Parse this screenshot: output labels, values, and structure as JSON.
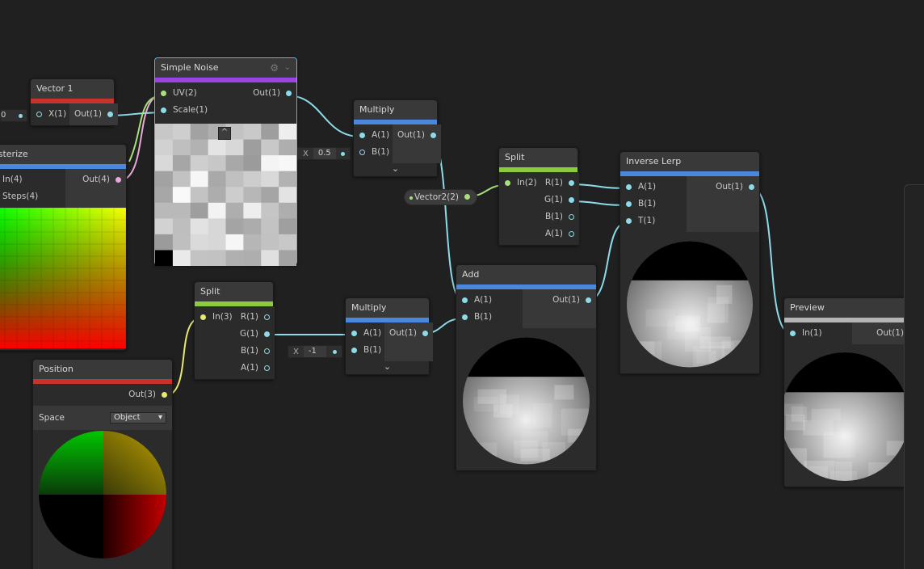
{
  "nodes": {
    "vector1": {
      "title": "Vector 1",
      "in0": "X(1)",
      "out0": "Out(1)",
      "inline_value": "0"
    },
    "posterize": {
      "title": "osterize",
      "in0": "In(4)",
      "in1": "Steps(4)",
      "out0": "Out(4)"
    },
    "simple_noise": {
      "title": "Simple Noise",
      "in0": "UV(2)",
      "in1": "Scale(1)",
      "out0": "Out(1)"
    },
    "multiply1": {
      "title": "Multiply",
      "in0": "A(1)",
      "in1": "B(1)",
      "out0": "Out(1)",
      "inline_label": "X",
      "inline_value": "0.5"
    },
    "vector2": {
      "label": "Vector2(2)"
    },
    "split1": {
      "title": "Split",
      "in0": "In(2)",
      "out0": "R(1)",
      "out1": "G(1)",
      "out2": "B(1)",
      "out3": "A(1)"
    },
    "inverse_lerp": {
      "title": "Inverse Lerp",
      "in0": "A(1)",
      "in1": "B(1)",
      "in2": "T(1)",
      "out0": "Out(1)"
    },
    "add": {
      "title": "Add",
      "in0": "A(1)",
      "in1": "B(1)",
      "out0": "Out(1)"
    },
    "preview": {
      "title": "Preview",
      "in0": "In(1)",
      "out0": "Out(1)"
    },
    "split2": {
      "title": "Split",
      "in0": "In(3)",
      "out0": "R(1)",
      "out1": "G(1)",
      "out2": "B(1)",
      "out3": "A(1)"
    },
    "multiply2": {
      "title": "Multiply",
      "in0": "A(1)",
      "in1": "B(1)",
      "out0": "Out(1)",
      "inline_label": "X",
      "inline_value": "-1"
    },
    "position": {
      "title": "Position",
      "out0": "Out(3)",
      "setting_label": "Space",
      "setting_value": "Object"
    }
  },
  "colors": {
    "background": "#202020",
    "wire": "#8bdbe8",
    "selection": "#44c0e0",
    "bar_red": "#c8322c",
    "bar_blue": "#4a88e0",
    "bar_purple": "#9a44e6",
    "bar_green": "#8ccc3c",
    "bar_gray": "#b4b4b4"
  }
}
